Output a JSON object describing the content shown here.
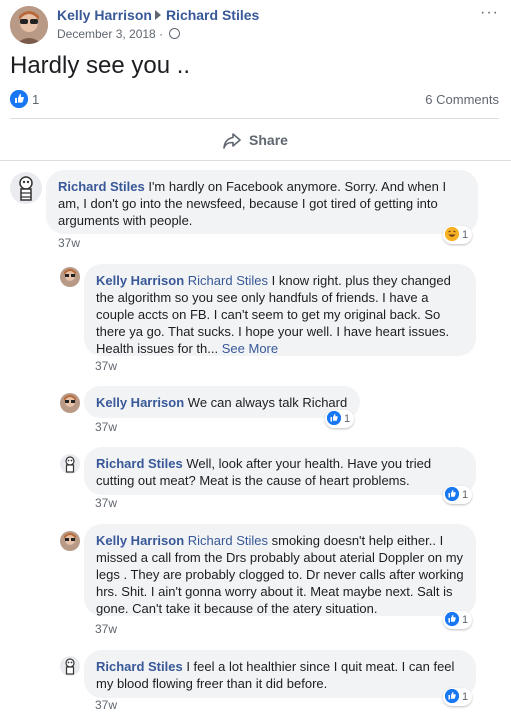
{
  "post": {
    "author": "Kelly Harrison",
    "target": "Richard Stiles",
    "date": "December 3, 2018",
    "more_icon": "more-horizontal-icon",
    "text": "Hardly see you ..",
    "like_count": "1",
    "comments_count": "6 Comments",
    "share_label": "Share"
  },
  "comments": [
    {
      "author": "Richard Stiles",
      "text": "I'm hardly on Facebook anymore. Sorry. And when I am, I don't go into the newsfeed, because I got tired of getting into arguments with people.",
      "time": "37w",
      "reaction": {
        "type": "haha",
        "count": "1"
      }
    },
    {
      "author": "Kelly Harrison",
      "mention": "Richard Stiles",
      "text": "I know right. plus they changed the algorithm so you see only handfuls of friends. I have a couple accts on FB. I can't seem to get my original back. So there ya go. That sucks. I hope your well. I have heart issues. Health issues for th...",
      "see_more": "See More",
      "time": "37w"
    },
    {
      "author": "Kelly Harrison",
      "text": "We can always talk Richard",
      "time": "37w",
      "reaction": {
        "type": "like",
        "count": "1"
      }
    },
    {
      "author": "Richard Stiles",
      "text": "Well, look after your health. Have you tried cutting out meat? Meat is the cause of heart problems.",
      "time": "37w",
      "reaction": {
        "type": "like",
        "count": "1"
      }
    },
    {
      "author": "Kelly Harrison",
      "mention": "Richard Stiles",
      "text": "smoking doesn't help either.. I missed a call from the Drs probably about aterial Doppler on my legs . They are probably clogged to. Dr never calls after working hrs. Shit. I ain't gonna worry about it. Meat maybe next. Salt is gone. Can't take it because of the atery situation.",
      "time": "37w",
      "reaction": {
        "type": "like",
        "count": "1"
      }
    },
    {
      "author": "Richard Stiles",
      "text": "I feel a lot healthier since I quit meat. I can feel my blood flowing freer than it did before.",
      "time": "37w",
      "reaction": {
        "type": "like",
        "count": "1"
      }
    }
  ]
}
